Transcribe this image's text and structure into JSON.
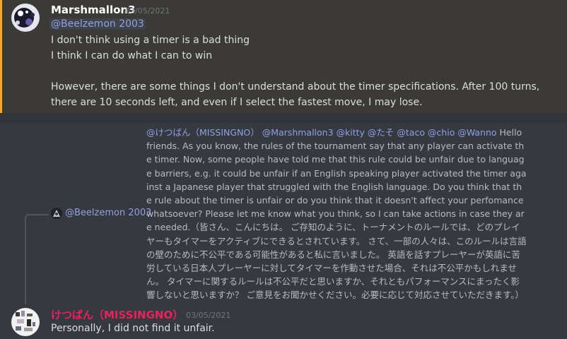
{
  "message1": {
    "author": "Marshmallon3",
    "timestamp": "03/05/2021",
    "mention": "@Beelzemon 2003",
    "lines": [
      "I don't think using a timer is a bad thing",
      "I think I can do what I can to win",
      "However, there are some things I don't understand about the timer specifications. After 100 turns,",
      "there are 10 seconds left, and even if I select the fastest move, I may lose."
    ]
  },
  "reply": {
    "reply_to_name": "@Beelzemon 2003",
    "quoted_mentions": "@けつばん（MISSINGNO） @Marshmallon3 @kitty @たそ @taco @chio @Wanno",
    "quoted_english": " Hello friends. As you know, the rules of the tournament say that any player can activate the timer. Now, some people have told me that this rule could be unfair due to language barriers, e.g. it could be unfair if an English speaking player activated the timer against a Japanese player that struggled with the English language. Do you think that the rule about the timer is unfair or do you think that it doesn't affect your perfomance whatsoever? Please let me know what you think, so I can take actions in case they are needed.",
    "quoted_japanese": "（皆さん、こんにちは。 ご存知のように、トーナメントのルールでは、どのプレイヤーもタイマーをアクティブにできるとされています。 さて、一部の人々は、このルールは言語の壁のために不公平である可能性があると私に言いました。 英語を話すプレーヤーが英語に苦労している日本人プレーヤーに対してタイマーを作動させた場合、それは不公平かもしれません。 タイマーに関するルールは不公平だと思いますか、それともパフォーマンスにまったく影響しないと思いますか？ ご意見をお聞かせください。必要に応じて対応させていただきます。）"
  },
  "message2": {
    "author": "けつばん（MISSINGNO）",
    "timestamp": "03/05/2021",
    "text": "Personally, I did not find it unfair."
  },
  "colors": {
    "background": "#36393f",
    "mention_highlight": "#faa61a",
    "mention_text": "#8ea1e1",
    "author_red": "#ed1f5c"
  },
  "icons": {
    "avatar1": "marshmallon3-avatar",
    "reply_avatar": "beelzemon-avatar",
    "avatar2": "missingno-avatar"
  }
}
